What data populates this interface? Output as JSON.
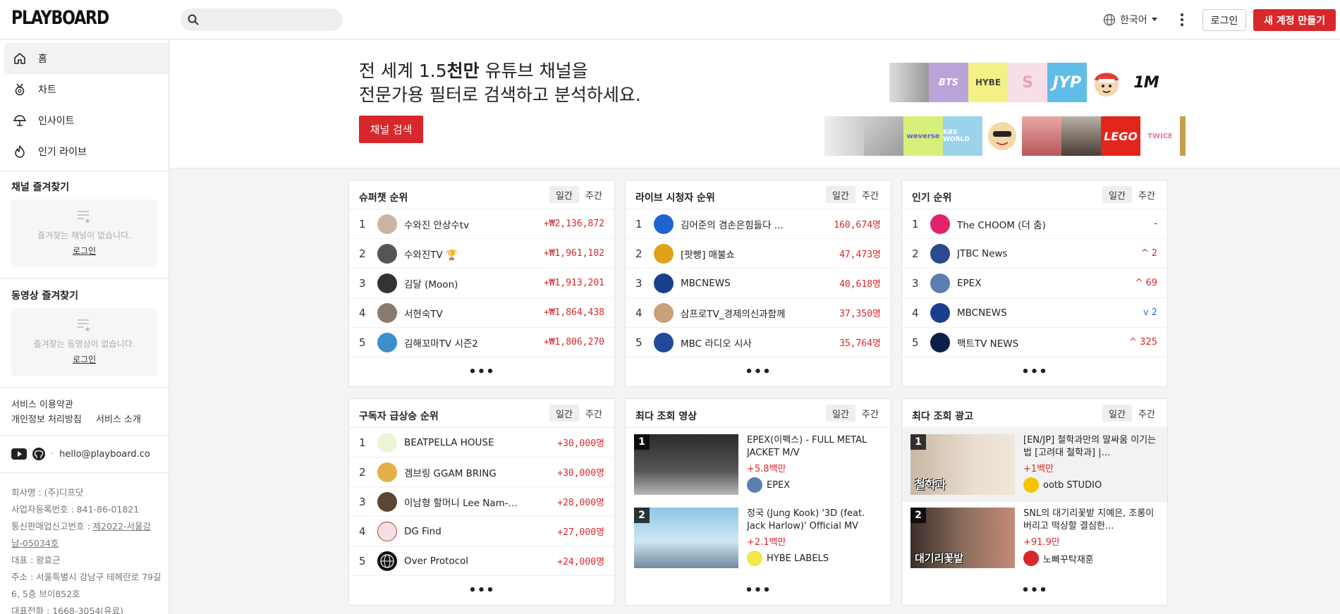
{
  "header": {
    "logo": "PLAYBOARD",
    "search_placeholder": "",
    "language": "한국어",
    "login": "로그인",
    "signup": "새 계정 만들기"
  },
  "sidebar": {
    "nav": [
      {
        "label": "홈",
        "icon": "home-icon",
        "active": true
      },
      {
        "label": "차트",
        "icon": "medal-icon",
        "active": false
      },
      {
        "label": "인사이트",
        "icon": "lightbulb-icon",
        "active": false
      },
      {
        "label": "인기 라이브",
        "icon": "flame-icon",
        "active": false
      }
    ],
    "channel_fav": {
      "title": "채널 즐겨찾기",
      "empty_text": "즐겨찾는 채널이 없습니다.",
      "login": "로그인"
    },
    "video_fav": {
      "title": "동영상 즐겨찾기",
      "empty_text": "즐겨찾는 동영상이 없습니다.",
      "login": "로그인"
    },
    "links": {
      "terms": "서비스 이용약관",
      "privacy": "개인정보 처리방침",
      "about": "서비스 소개"
    },
    "email": "hello@playboard.co",
    "company": {
      "name": "회사명 : (주)디프닷",
      "biz_no": "사업자등록번호 : 841-86-01821",
      "mail_order_label": "통신판매업신고번호 : ",
      "mail_order_no": "제2022-서울강남-05034호",
      "ceo": "대표 : 왕효근",
      "address": "주소 : 서울특별시 강남구 테헤란로 79길 6, 5층 브이852호",
      "phone": "대표전화 : 1668-3054(유료)"
    }
  },
  "banner": {
    "line1_a": "전 세계 1.5",
    "line1_b": "천만",
    "line1_c": " 유튜브 채널을",
    "line2": "전문가용 필터로 검색하고 분석하세요.",
    "button": "채널 검색",
    "tiles_top": [
      "",
      "BTS",
      "HYBE",
      "S",
      "JYP",
      "",
      "1M"
    ],
    "tiles_bottom": [
      "",
      "",
      "weverse",
      "KBS WORLD",
      "",
      "",
      "",
      "LEGO",
      "TWICE",
      ""
    ]
  },
  "cards": {
    "superchat": {
      "title": "슈퍼챗 순위",
      "tab_daily": "일간",
      "tab_weekly": "주간",
      "rows": [
        {
          "rank": "1",
          "name": "수와진 안상수tv",
          "value": "+₩2,136,872"
        },
        {
          "rank": "2",
          "name": "수와진TV 🏆",
          "value": "+₩1,961,102"
        },
        {
          "rank": "3",
          "name": "김달 (Moon)",
          "value": "+₩1,913,201"
        },
        {
          "rank": "4",
          "name": "서현숙TV",
          "value": "+₩1,864,438"
        },
        {
          "rank": "5",
          "name": "김해꼬마TV 시즌2",
          "value": "+₩1,806,270"
        }
      ],
      "more": "•••"
    },
    "live": {
      "title": "라이브 시청자 순위",
      "tab_daily": "일간",
      "tab_weekly": "주간",
      "rows": [
        {
          "rank": "1",
          "name": "김어준의 겸손은힘들다 ...",
          "value": "160,674명"
        },
        {
          "rank": "2",
          "name": "[팟빵] 매불쇼",
          "value": "47,473명"
        },
        {
          "rank": "3",
          "name": "MBCNEWS",
          "value": "40,618명"
        },
        {
          "rank": "4",
          "name": "삼프로TV_경제의신과함께",
          "value": "37,350명"
        },
        {
          "rank": "5",
          "name": "MBC 라디오 시사",
          "value": "35,764명"
        }
      ],
      "more": "•••"
    },
    "popular": {
      "title": "인기 순위",
      "tab_daily": "일간",
      "tab_weekly": "주간",
      "rows": [
        {
          "rank": "1",
          "name": "The CHOOM (더 춤)",
          "value": "-"
        },
        {
          "rank": "2",
          "name": "JTBC News",
          "value": "2"
        },
        {
          "rank": "3",
          "name": "EPEX",
          "value": "69"
        },
        {
          "rank": "4",
          "name": "MBCNEWS",
          "value": "2"
        },
        {
          "rank": "5",
          "name": "팩트TV NEWS",
          "value": "325"
        }
      ],
      "more": "•••"
    },
    "subs": {
      "title": "구독자 급상승 순위",
      "tab_daily": "일간",
      "tab_weekly": "주간",
      "rows": [
        {
          "rank": "1",
          "name": "BEATPELLA HOUSE",
          "value": "+30,000명"
        },
        {
          "rank": "2",
          "name": "겜브링 GGAM BRING",
          "value": "+30,000명"
        },
        {
          "rank": "3",
          "name": "이남형 할머니 Lee Nam-...",
          "value": "+28,000명"
        },
        {
          "rank": "4",
          "name": "DG Find",
          "value": "+27,000명"
        },
        {
          "rank": "5",
          "name": "Over Protocol",
          "value": "+24,000명"
        }
      ],
      "more": "•••"
    },
    "videos": {
      "title": "최다 조회 영상",
      "tab_daily": "일간",
      "tab_weekly": "주간",
      "rows": [
        {
          "rank": "1",
          "title": "EPEX(이펙스) - FULL METAL JACKET M/V",
          "views": "+5.8백만",
          "channel": "EPEX"
        },
        {
          "rank": "2",
          "title": "정국 (Jung Kook) '3D (feat. Jack Harlow)' Official MV",
          "views": "+2.1백만",
          "channel": "HYBE LABELS"
        }
      ],
      "more": "•••"
    },
    "ads": {
      "title": "최다 조회 광고",
      "tab_daily": "일간",
      "tab_weekly": "주간",
      "rows": [
        {
          "rank": "1",
          "title": "[EN/JP] 철학과만의 말싸움 이기는 법 [고려대 철학과] |...",
          "views": "+1백만",
          "channel": "ootb STUDIO",
          "thumb_text": "철학과"
        },
        {
          "rank": "2",
          "title": "SNL의 대기리꽃밭 지예은, 조롱이 버리고 떡상할 결심한...",
          "views": "+91.9만",
          "channel": "노빠꾸탁재훈",
          "thumb_text": "대기리꽃밭"
        }
      ],
      "more": "•••"
    }
  },
  "colors": {
    "accent": "#d8282b",
    "down": "#2a6fd6"
  }
}
